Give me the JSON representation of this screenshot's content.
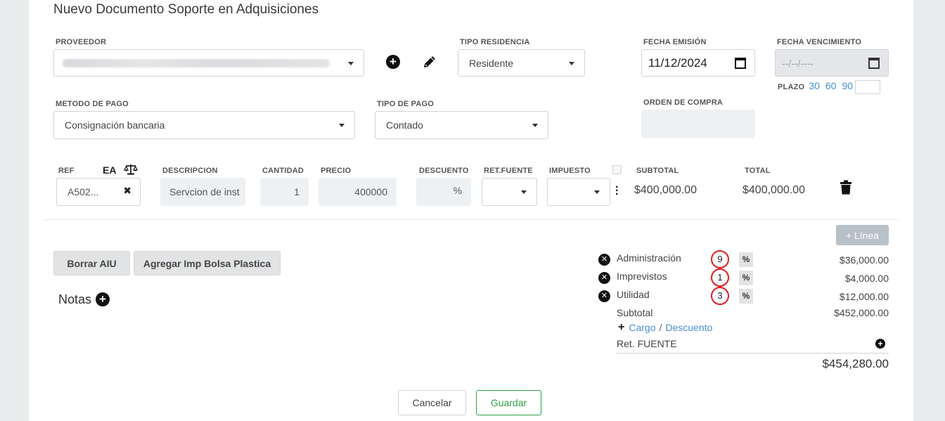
{
  "title": "Nuevo Documento Soporte en Adquisiciones",
  "proveedor": {
    "label": "PROVEEDOR"
  },
  "tipo_residencia": {
    "label": "TIPO RESIDENCIA",
    "value": "Residente"
  },
  "fecha_emision": {
    "label": "FECHA EMISIÓN",
    "value": "11/12/2024"
  },
  "fecha_vencimiento": {
    "label": "FECHA VENCIMIENTO",
    "placeholder": "--/--/----"
  },
  "plazo": {
    "label": "PLAZO",
    "options": [
      "30",
      "60",
      "90"
    ]
  },
  "metodo_pago": {
    "label": "METODO DE PAGO",
    "value": "Consignación bancaria"
  },
  "tipo_pago": {
    "label": "TIPO DE PAGO",
    "value": "Contado"
  },
  "orden_compra": {
    "label": "ORDEN DE COMPRA"
  },
  "lines": {
    "headers": {
      "ref": "REF",
      "ea": "EA",
      "descripcion": "DESCRIPCION",
      "cantidad": "CANTIDAD",
      "precio": "PRECIO",
      "descuento": "DESCUENTO",
      "retfuente": "RET.FUENTE",
      "impuesto": "IMPUESTO",
      "subtotal": "SUBTOTAL",
      "total": "TOTAL"
    },
    "row": {
      "ref": "A502...",
      "descripcion": "Servcion de inst",
      "cantidad": "1",
      "precio": "400000",
      "descuento_suffix": "%",
      "subtotal": "$400,000.00",
      "total": "$400,000.00"
    }
  },
  "buttons": {
    "add_line": "+ Línea",
    "borrar_aiu": "Borrar AIU",
    "agregar_bolsa": "Agregar Imp Bolsa Plastica",
    "cancelar": "Cancelar",
    "guardar": "Guardar"
  },
  "notas": {
    "label": "Notas"
  },
  "aiu": [
    {
      "label": "Administración",
      "pct": "9",
      "value": "$36,000.00"
    },
    {
      "label": "Imprevistos",
      "pct": "1",
      "value": "$4,000.00"
    },
    {
      "label": "Utilidad",
      "pct": "3",
      "value": "$12,000.00"
    }
  ],
  "totals": {
    "subtotal_label": "Subtotal",
    "subtotal_value": "$452,000.00",
    "cargo": "Cargo",
    "separator": "/",
    "descuento": "Descuento",
    "ret_fuente_label": "Ret. FUENTE",
    "grand_total": "$454,280.00"
  }
}
